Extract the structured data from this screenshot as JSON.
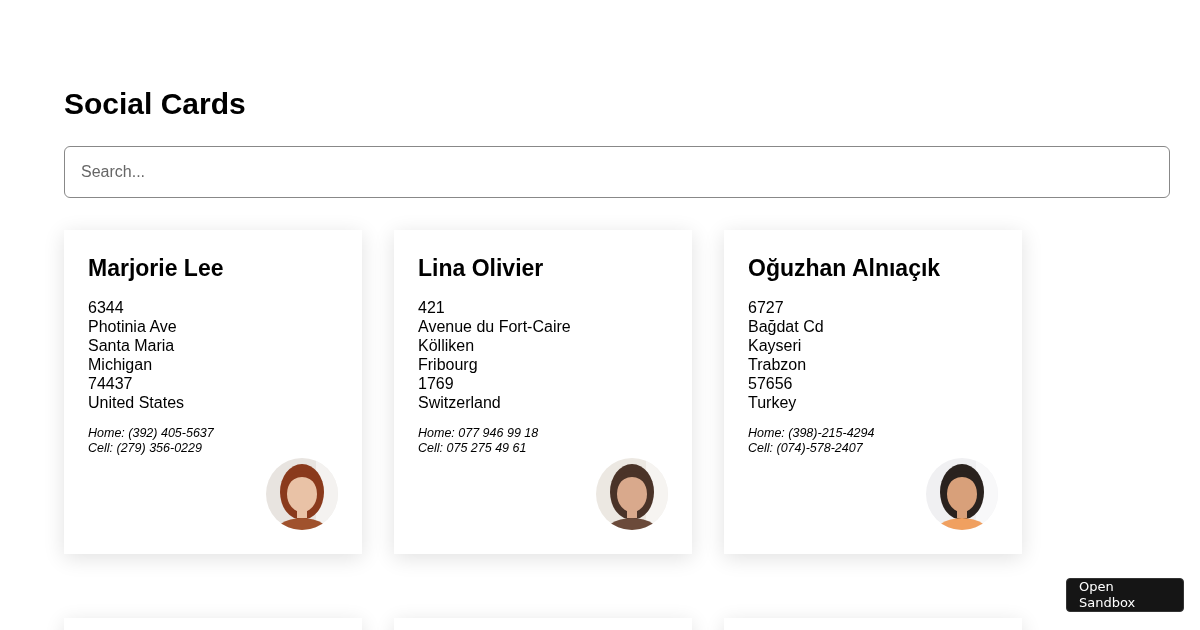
{
  "title": "Social Cards",
  "search": {
    "placeholder": "Search..."
  },
  "cards": [
    {
      "name": "Marjorie Lee",
      "address": [
        "6344",
        "Photinia Ave",
        "Santa Maria",
        "Michigan",
        "74437",
        "United States"
      ],
      "phones": [
        "Home: (392) 405-5637",
        "Cell: (279) 356-0229"
      ],
      "avatar": {
        "kind": "picture"
      }
    },
    {
      "name": "Lina Olivier",
      "address": [
        "421",
        "Avenue du Fort-Caire",
        "Kölliken",
        "Fribourg",
        "1769",
        "Switzerland"
      ],
      "phones": [
        "Home: 077 946 99 18",
        "Cell: 075 275 49 61"
      ],
      "avatar": {
        "kind": "picture"
      }
    },
    {
      "name": "Oğuzhan Alnıaçık",
      "address": [
        "6727",
        "Bağdat Cd",
        "Kayseri",
        "Trabzon",
        "57656",
        "Turkey"
      ],
      "phones": [
        "Home: (398)-215-4294",
        "Cell: (074)-578-2407"
      ],
      "avatar": {
        "kind": "picture"
      }
    }
  ],
  "next_row_cards": [
    {
      "kind": "card"
    },
    {
      "kind": "card"
    },
    {
      "kind": "card"
    }
  ],
  "sandbox_button": {
    "label": "Open Sandbox"
  }
}
